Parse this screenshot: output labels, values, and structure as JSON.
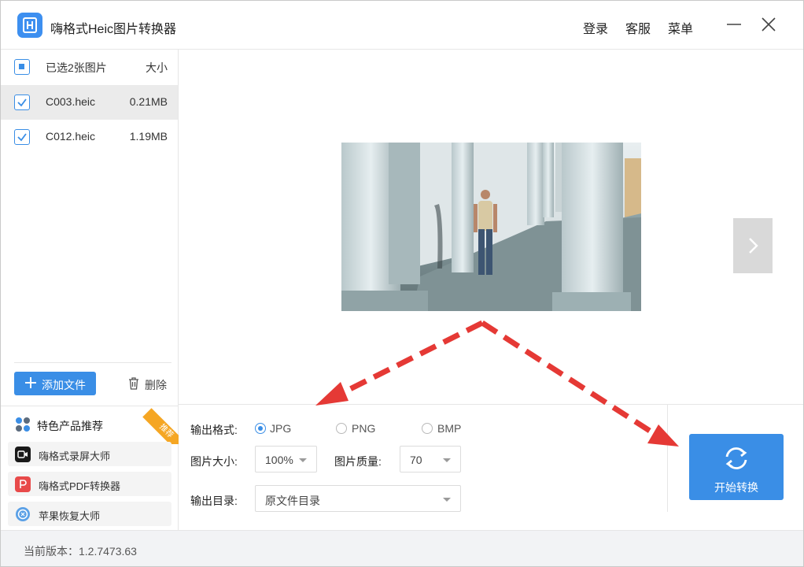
{
  "app": {
    "title": "嗨格式Heic图片转换器"
  },
  "header": {
    "login": "登录",
    "service": "客服",
    "menu": "菜单"
  },
  "file_list": {
    "select_all_label": "已选2张图片",
    "size_header": "大小",
    "files": [
      {
        "name": "C003.heic",
        "size": "0.21MB",
        "checked": true,
        "selected": true
      },
      {
        "name": "C012.heic",
        "size": "1.19MB",
        "checked": true,
        "selected": false
      }
    ],
    "add_button": "添加文件",
    "delete_button": "删除"
  },
  "recommend": {
    "title": "特色产品推荐",
    "badge": "推荐",
    "items": [
      {
        "label": "嗨格式录屏大师",
        "icon": "screen-recorder-icon",
        "color": "#1a1a1a"
      },
      {
        "label": "嗨格式PDF转换器",
        "icon": "pdf-converter-icon",
        "color": "#e84a4a"
      },
      {
        "label": "苹果恢复大师",
        "icon": "apple-recovery-icon",
        "color": "#5aa0e6"
      }
    ]
  },
  "settings": {
    "format_label": "输出格式:",
    "formats": [
      {
        "label": "JPG",
        "checked": true
      },
      {
        "label": "PNG",
        "checked": false
      },
      {
        "label": "BMP",
        "checked": false
      }
    ],
    "size_label": "图片大小:",
    "size_value": "100%",
    "quality_label": "图片质量:",
    "quality_value": "70",
    "dir_label": "输出目录:",
    "dir_value": "原文件目录",
    "start_button": "开始转换"
  },
  "footer": {
    "version": "当前版本：1.2.7473.63"
  },
  "colors": {
    "accent": "#3a8ee6",
    "badge": "#f5a623",
    "arrow": "#e53935"
  }
}
